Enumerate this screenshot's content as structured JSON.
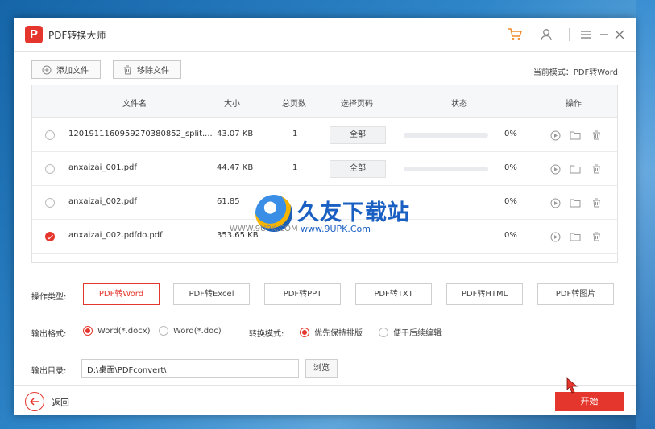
{
  "app": {
    "title": "PDF转换大师",
    "logo_letter": "P"
  },
  "toolbar": {
    "add_file": "添加文件",
    "remove_file": "移除文件",
    "current_mode": "当前模式：PDF转Word"
  },
  "table": {
    "headers": {
      "name": "文件名",
      "size": "大小",
      "pages": "总页数",
      "select": "选择页码",
      "status": "状态",
      "ops": "操作"
    },
    "rows": [
      {
        "name": "1201911160959270380852_split....",
        "size": "43.07 KB",
        "pages": "1",
        "select": "全部",
        "pct": "0%",
        "progress": 0,
        "checked": false
      },
      {
        "name": "anxaizai_001.pdf",
        "size": "44.47 KB",
        "pages": "1",
        "select": "全部",
        "pct": "0%",
        "progress": 0,
        "checked": false
      },
      {
        "name": "anxaizai_002.pdf",
        "size": "61.85",
        "pages": "",
        "select": "",
        "pct": "0%",
        "progress": 0,
        "checked": false
      },
      {
        "name": "anxaizai_002.pdfdo.pdf",
        "size": "353.65 KB",
        "pages": "",
        "select": "",
        "pct": "0%",
        "progress": 0,
        "checked": true
      }
    ]
  },
  "operation": {
    "type_label": "操作类型:",
    "types": [
      "PDF转Word",
      "PDF转Excel",
      "PDF转PPT",
      "PDF转TXT",
      "PDF转HTML",
      "PDF转图片"
    ],
    "active_type": 0,
    "format_label": "输出格式:",
    "format_docx": "Word(*.docx)",
    "format_doc": "Word(*.doc)",
    "convert_label": "转换模式:",
    "mode_layout": "优先保持排版",
    "mode_edit": "便于后续编辑",
    "dir_label": "输出目录:",
    "dir_value": "D:\\桌面\\PDFconvert\\",
    "browse": "浏览"
  },
  "footer": {
    "back": "返回",
    "start": "开始"
  },
  "watermark": {
    "main": "久友下载站",
    "url": "www.9UPK.Com",
    "left": "WWW.9UPK.COM"
  },
  "colors": {
    "accent": "#e5362d",
    "watermark": "#1a5fc2"
  }
}
